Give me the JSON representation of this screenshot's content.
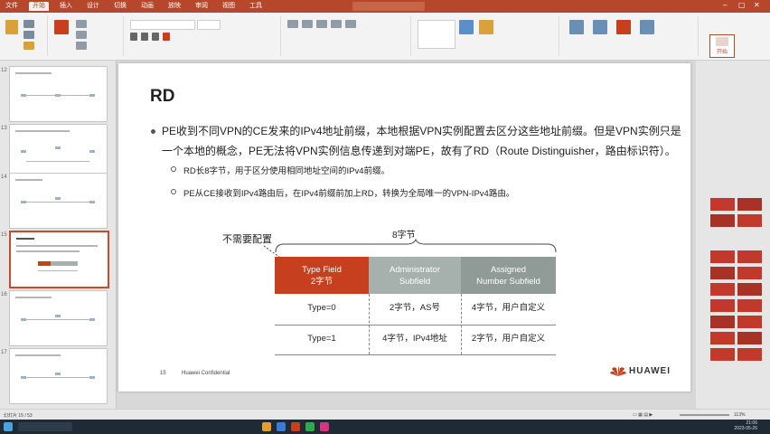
{
  "window": {
    "tabs": [
      "文件",
      "开始",
      "插入",
      "设计",
      "切换",
      "动画",
      "放映",
      "审阅",
      "视图",
      "工具"
    ],
    "active_tab_index": 1,
    "start_button": "开始",
    "brand_color": "#b7472a"
  },
  "slide": {
    "title": "RD",
    "bullet1": "PE收到不同VPN的CE发来的IPv4地址前缀，本地根据VPN实例配置去区分这些地址前缀。但是VPN实例只是一个本地的概念，PE无法将VPN实例信息传递到对端PE，故有了RD（Route Distinguisher，路由标识符）。",
    "sub1": "RD长8字节，用于区分使用相同地址空间的IPv4前缀。",
    "sub2": "PE从CE接收到IPv4路由后，在IPv4前缀前加上RD，转换为全局唯一的VPN-IPv4路由。",
    "diagram": {
      "bytes_label": "8字节",
      "no_config_label": "不需要配置",
      "headers": [
        {
          "line1": "Type Field",
          "line2": "2字节",
          "color": "#c6401f"
        },
        {
          "line1": "Administrator",
          "line2": "Subfield",
          "color": "#a6b0ad"
        },
        {
          "line1": "Assigned",
          "line2": "Number Subfield",
          "color": "#909a97"
        }
      ],
      "rows": [
        [
          "Type=0",
          "2字节，AS号",
          "4字节，用户自定义"
        ],
        [
          "Type=1",
          "4字节，IPv4地址",
          "2字节，用户自定义"
        ]
      ]
    },
    "footer_page": "15",
    "footer_text": "Huawei Confidential",
    "logo_text": "HUAWEI"
  },
  "statusbar": {
    "left": "幻灯片 15 / 53",
    "zoom": "113%"
  },
  "taskbar": {
    "time": "21:06",
    "date": "2023-05-26"
  }
}
